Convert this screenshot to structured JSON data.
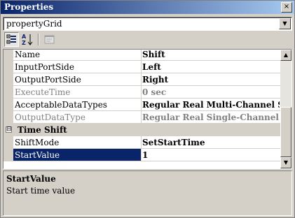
{
  "window": {
    "title": "Properties",
    "close_glyph": "×"
  },
  "selector": {
    "value": "propertyGrid",
    "dropdown_glyph": "▼"
  },
  "toolbar": {
    "categorized_icon": "categorized-icon",
    "alphabetical_icon": "alphabetical-icon",
    "property_pages_icon": "property-pages-icon"
  },
  "grid": {
    "rows": [
      {
        "type": "property",
        "name": "Name",
        "value": "Shift",
        "state": "normal"
      },
      {
        "type": "property",
        "name": "InputPortSide",
        "value": "Left",
        "state": "normal"
      },
      {
        "type": "property",
        "name": "OutputPortSide",
        "value": "Right",
        "state": "normal"
      },
      {
        "type": "property",
        "name": "ExecuteTime",
        "value": "0 sec",
        "state": "disabled"
      },
      {
        "type": "property",
        "name": "AcceptableDataTypes",
        "value": "Regular Real Multi-Channel Signal",
        "state": "normal"
      },
      {
        "type": "property",
        "name": "OutputDataType",
        "value": "Regular Real Single-Channel Signal",
        "state": "disabled"
      },
      {
        "type": "category",
        "name": "Time Shift",
        "expander": "⊟"
      },
      {
        "type": "property",
        "name": "ShiftMode",
        "value": "SetStartTime",
        "state": "normal"
      },
      {
        "type": "property",
        "name": "StartValue",
        "value": "1",
        "state": "selected"
      }
    ],
    "scroll_up_glyph": "▲",
    "scroll_down_glyph": "▼"
  },
  "description": {
    "title": "StartValue",
    "text": "Start time value"
  }
}
